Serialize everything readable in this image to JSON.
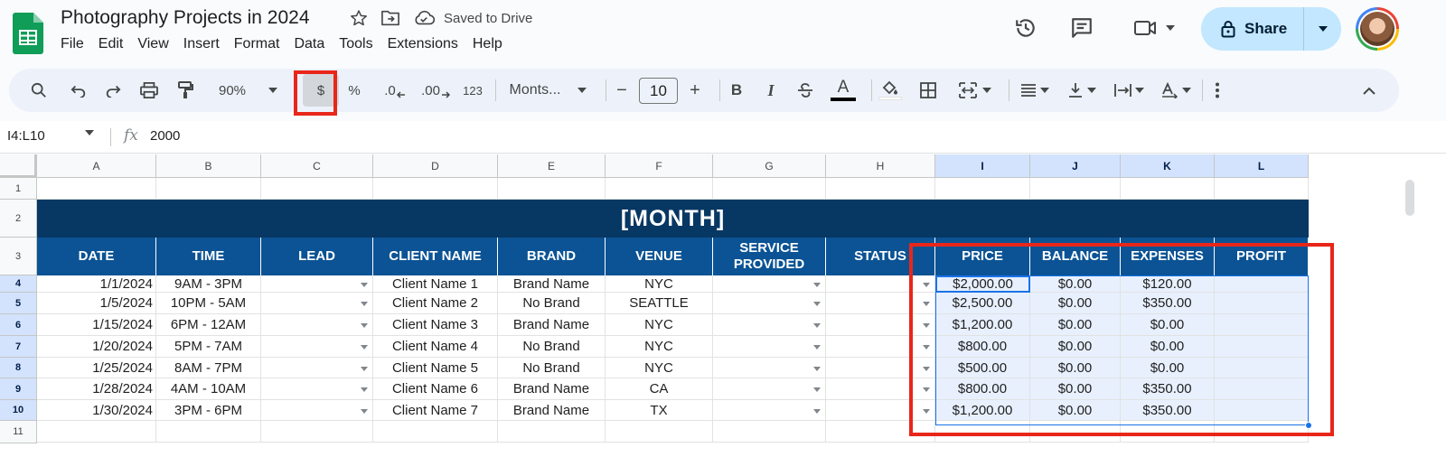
{
  "app": {
    "title": "Photography Projects in 2024",
    "saved_status": "Saved to Drive",
    "menu": [
      "File",
      "Edit",
      "View",
      "Insert",
      "Format",
      "Data",
      "Tools",
      "Extensions",
      "Help"
    ],
    "share_label": "Share"
  },
  "toolbar": {
    "zoom": "90%",
    "currency": "$",
    "percent": "%",
    "decrease_decimal": ".0",
    "increase_decimal": ".00",
    "more_formats": "123",
    "font": "Monts...",
    "font_size": "10",
    "minus": "−",
    "plus": "+",
    "bold": "B",
    "italic": "I",
    "text_color": "A"
  },
  "formula_bar": {
    "range": "I4:L10",
    "fx": "fx",
    "value": "2000"
  },
  "columns": [
    "A",
    "B",
    "C",
    "D",
    "E",
    "F",
    "G",
    "H",
    "I",
    "J",
    "K",
    "L"
  ],
  "rows": [
    "1",
    "2",
    "3",
    "4",
    "5",
    "6",
    "7",
    "8",
    "9",
    "10",
    "11"
  ],
  "sheet": {
    "month_title": "[MONTH]",
    "headers": [
      "DATE",
      "TIME",
      "LEAD",
      "CLIENT NAME",
      "BRAND",
      "VENUE",
      "SERVICE PROVIDED",
      "STATUS",
      "PRICE",
      "BALANCE",
      "EXPENSES",
      "PROFIT"
    ],
    "data": [
      [
        "1/1/2024",
        "9AM - 3PM",
        "",
        "Client Name 1",
        "Brand Name",
        "NYC",
        "",
        "",
        "$2,000.00",
        "$0.00",
        "$120.00",
        ""
      ],
      [
        "1/5/2024",
        "10PM - 5AM",
        "",
        "Client Name 2",
        "No Brand",
        "SEATTLE",
        "",
        "",
        "$2,500.00",
        "$0.00",
        "$350.00",
        ""
      ],
      [
        "1/15/2024",
        "6PM - 12AM",
        "",
        "Client Name 3",
        "Brand Name",
        "NYC",
        "",
        "",
        "$1,200.00",
        "$0.00",
        "$0.00",
        ""
      ],
      [
        "1/20/2024",
        "5PM - 7AM",
        "",
        "Client Name 4",
        "No Brand",
        "NYC",
        "",
        "",
        "$800.00",
        "$0.00",
        "$0.00",
        ""
      ],
      [
        "1/25/2024",
        "8AM - 7PM",
        "",
        "Client Name 5",
        "No Brand",
        "NYC",
        "",
        "",
        "$500.00",
        "$0.00",
        "$0.00",
        ""
      ],
      [
        "1/28/2024",
        "4AM - 10AM",
        "",
        "Client Name 6",
        "Brand Name",
        "CA",
        "",
        "",
        "$800.00",
        "$0.00",
        "$350.00",
        ""
      ],
      [
        "1/30/2024",
        "3PM - 6PM",
        "",
        "Client Name 7",
        "Brand Name",
        "TX",
        "",
        "",
        "$1,200.00",
        "$0.00",
        "$350.00",
        ""
      ]
    ]
  },
  "colors": {
    "month_bg": "#073763",
    "header_bg": "#0b5394",
    "selection": "#1a73e8",
    "highlight_red": "#e8261a",
    "share_bg": "#c2e7ff"
  }
}
